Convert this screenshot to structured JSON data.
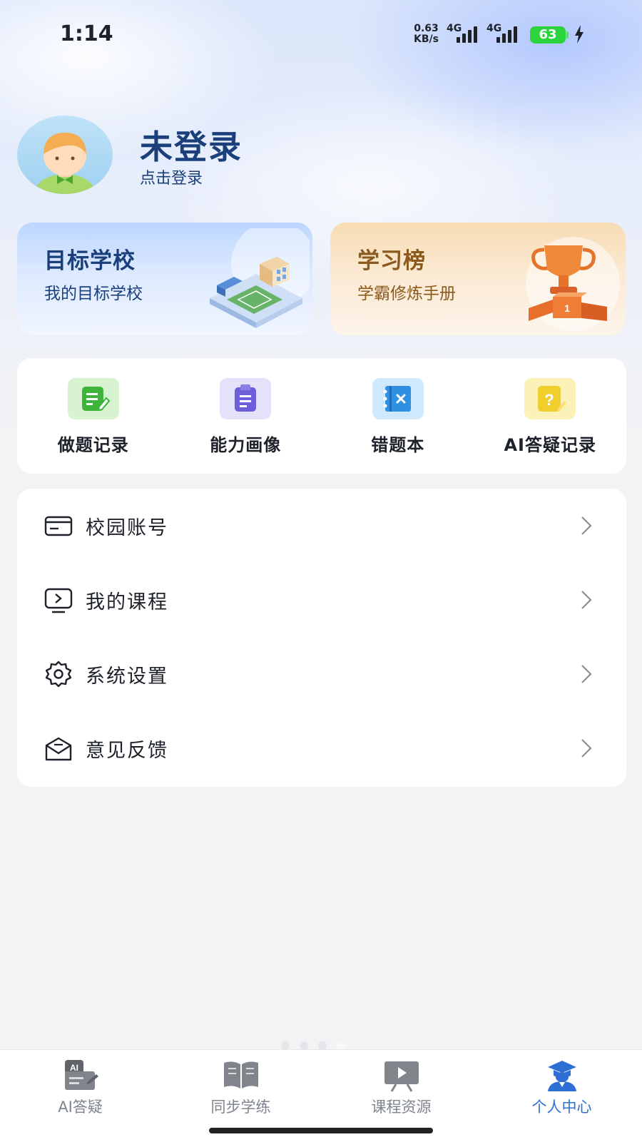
{
  "status_bar": {
    "time": "1:14",
    "net_speed_value": "0.63",
    "net_speed_unit": "KB/s",
    "signal_1_type": "4G",
    "signal_2_type": "4G",
    "battery": "63"
  },
  "profile": {
    "name": "未登录",
    "login_hint": "点击登录"
  },
  "cards": {
    "target_school": {
      "title": "目标学校",
      "subtitle": "我的目标学校",
      "icon": "school-building-icon"
    },
    "leaderboard": {
      "title": "学习榜",
      "subtitle": "学霸修炼手册",
      "icon": "trophy-podium-icon"
    }
  },
  "tools": [
    {
      "label": "做题记录",
      "icon": "edit-note-icon",
      "color": "#3fb43c"
    },
    {
      "label": "能力画像",
      "icon": "clipboard-icon",
      "color": "#6c5fd9"
    },
    {
      "label": "错题本",
      "icon": "error-notebook-icon",
      "color": "#2f8fe0"
    },
    {
      "label": "AI答疑记录",
      "icon": "question-note-icon",
      "color": "#f0cf2c"
    }
  ],
  "menu": [
    {
      "label": "校园账号",
      "icon": "card-icon"
    },
    {
      "label": "我的课程",
      "icon": "video-play-icon"
    },
    {
      "label": "系统设置",
      "icon": "gear-icon"
    },
    {
      "label": "意见反馈",
      "icon": "mail-feedback-icon"
    }
  ],
  "bottom_nav": [
    {
      "label": "AI答疑",
      "icon": "ai-doc-icon",
      "active": false
    },
    {
      "label": "同步学练",
      "icon": "open-book-icon",
      "active": false
    },
    {
      "label": "课程资源",
      "icon": "video-board-icon",
      "active": false
    },
    {
      "label": "个人中心",
      "icon": "student-cap-icon",
      "active": true
    }
  ],
  "colors": {
    "accent": "#2e6fd6",
    "title_blue": "#1b3f7a",
    "gold_text": "#8a5a1e",
    "battery_green": "#2bd33c"
  }
}
